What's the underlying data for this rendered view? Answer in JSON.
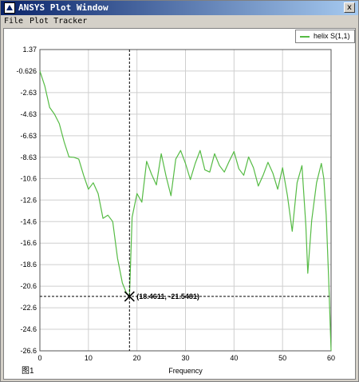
{
  "window": {
    "title": "ANSYS Plot Window",
    "close_glyph": "x"
  },
  "menu": {
    "items": [
      "File",
      "Plot Tracker"
    ]
  },
  "legend": {
    "label": "helix S(1,1)",
    "color": "#55bb44"
  },
  "figure_label": "图1",
  "marker": {
    "label": "(18.4611, -21.5481)",
    "icon": "x-marker-icon"
  },
  "chart_data": {
    "type": "line",
    "xlabel": "Frequency",
    "ylabel": "",
    "xlim": [
      0,
      60
    ],
    "ylim": [
      -26.6,
      1.37
    ],
    "x_ticks": [
      0,
      10,
      20,
      30,
      40,
      50,
      60
    ],
    "y_ticks": [
      1.37,
      -0.626,
      -2.63,
      -4.63,
      -6.63,
      -8.63,
      -10.6,
      -12.6,
      -14.6,
      -16.6,
      -18.6,
      -20.6,
      -22.6,
      -24.6,
      -26.6
    ],
    "grid": true,
    "legend_position": "top-right",
    "crosshair": {
      "x": 18.4611,
      "y": -21.5481
    },
    "series": [
      {
        "name": "helix S(1,1)",
        "color": "#55bb44",
        "x": [
          0,
          1,
          2,
          3,
          4,
          5,
          6,
          7,
          8,
          9,
          10,
          11,
          12,
          13,
          14,
          15,
          16,
          17,
          17.8,
          18.4611,
          19,
          20,
          21,
          22,
          23,
          24,
          25,
          26,
          27,
          28,
          29,
          30,
          31,
          32,
          33,
          34,
          35,
          36,
          37,
          38,
          39,
          40,
          41,
          42,
          43,
          44,
          45,
          46,
          47,
          48,
          49,
          50,
          51,
          52,
          53,
          54,
          54.8,
          55.2,
          56,
          57,
          58,
          58.5,
          59,
          59.5,
          60
        ],
        "y": [
          -0.626,
          -2.0,
          -4.0,
          -4.63,
          -5.5,
          -7.2,
          -8.6,
          -8.63,
          -8.8,
          -10.3,
          -11.6,
          -11.0,
          -12.0,
          -14.3,
          -14.0,
          -14.6,
          -18.0,
          -20.3,
          -21.2,
          -21.5481,
          -14.2,
          -12.0,
          -12.8,
          -9.0,
          -10.2,
          -11.2,
          -8.3,
          -10.4,
          -12.2,
          -8.8,
          -8.0,
          -9.2,
          -10.7,
          -9.2,
          -8.0,
          -9.8,
          -10.0,
          -8.3,
          -9.4,
          -10.0,
          -9.0,
          -8.1,
          -9.7,
          -10.3,
          -8.6,
          -9.6,
          -11.3,
          -10.3,
          -9.1,
          -10.1,
          -11.6,
          -9.6,
          -12.2,
          -15.5,
          -11.0,
          -9.4,
          -15.0,
          -19.4,
          -14.5,
          -11.0,
          -9.2,
          -10.6,
          -14.0,
          -20.0,
          -26.6
        ]
      }
    ]
  }
}
